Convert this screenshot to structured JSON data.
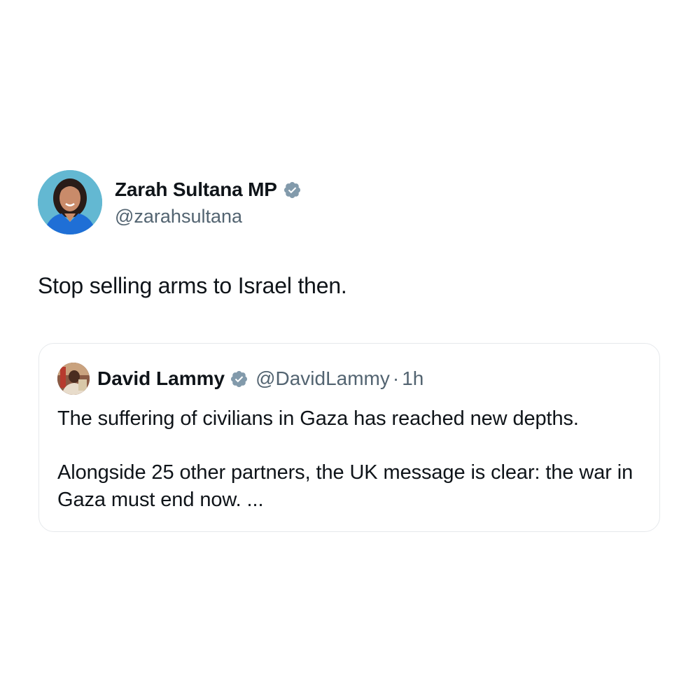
{
  "tweet": {
    "author": {
      "display_name": "Zarah Sultana MP",
      "handle": "@zarahsultana",
      "verified": true,
      "avatar_icon": "profile-photo"
    },
    "text": "Stop selling arms to Israel then."
  },
  "quoted_tweet": {
    "author": {
      "display_name": "David Lammy",
      "handle": "@DavidLammy",
      "verified": true,
      "avatar_icon": "profile-photo"
    },
    "separator": "·",
    "time": "1h",
    "paragraphs": [
      "The suffering of civilians in Gaza has reached new depths.",
      "Alongside 25 other partners, the UK message is clear: the war in Gaza must end now. ..."
    ]
  },
  "colors": {
    "text_primary": "#0f1419",
    "text_secondary": "#536471",
    "border": "#e6e9ec",
    "verified_badge": "#829aab"
  }
}
